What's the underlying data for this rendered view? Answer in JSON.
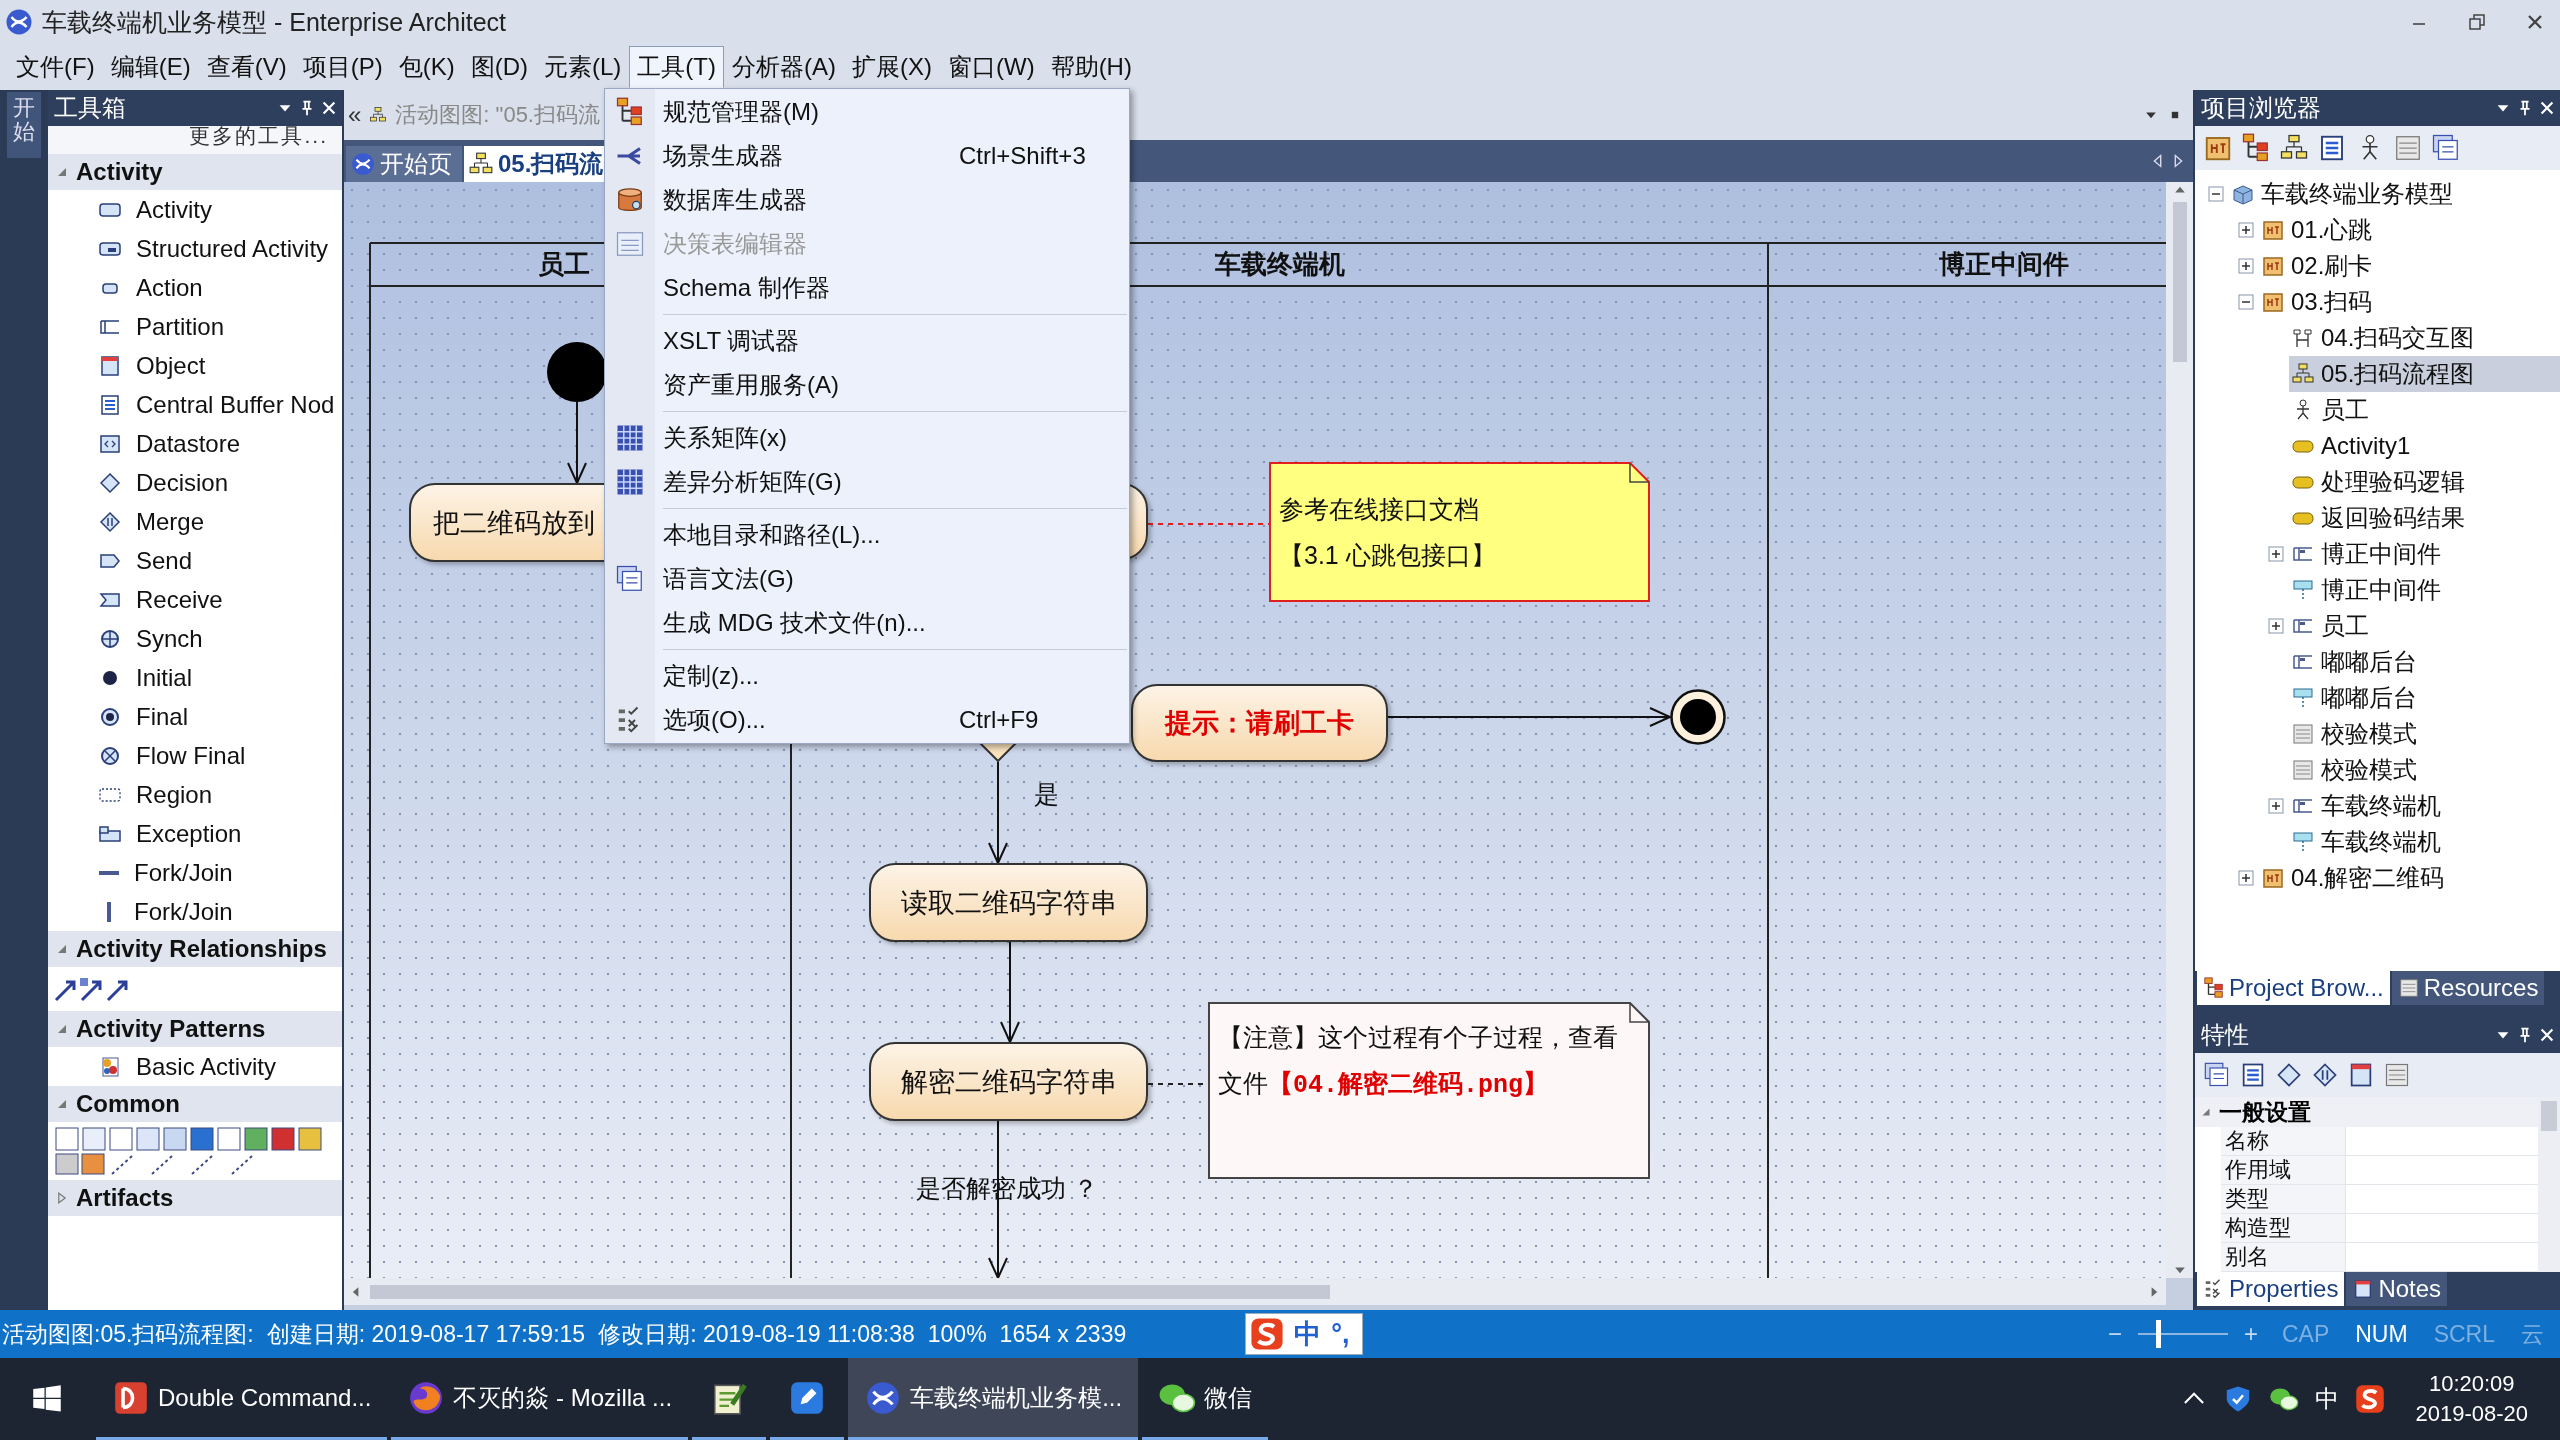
{
  "window": {
    "title": "车载终端机业务模型 - Enterprise Architect"
  },
  "menu_bar": [
    {
      "label": "文件(F)",
      "selected": false
    },
    {
      "label": "编辑(E)",
      "selected": false
    },
    {
      "label": "查看(V)",
      "selected": false
    },
    {
      "label": "项目(P)",
      "selected": false
    },
    {
      "label": "包(K)",
      "selected": false
    },
    {
      "label": "图(D)",
      "selected": false
    },
    {
      "label": "元素(L)",
      "selected": false
    },
    {
      "label": "工具(T)",
      "selected": true
    },
    {
      "label": "分析器(A)",
      "selected": false
    },
    {
      "label": "扩展(X)",
      "selected": false
    },
    {
      "label": "窗口(W)",
      "selected": false
    },
    {
      "label": "帮助(H)",
      "selected": false
    }
  ],
  "side_strip": {
    "tab": "开始"
  },
  "toolbox": {
    "title": "工具箱",
    "more": "更多的工具...",
    "sections": [
      {
        "title": "Activity",
        "expanded": true,
        "kind": "list",
        "items": [
          {
            "label": "Activity",
            "kind": "activity"
          },
          {
            "label": "Structured Activity",
            "kind": "structured"
          },
          {
            "label": "Action",
            "kind": "action"
          },
          {
            "label": "Partition",
            "kind": "partition"
          },
          {
            "label": "Object",
            "kind": "object"
          },
          {
            "label": "Central Buffer Nod",
            "kind": "buffer"
          },
          {
            "label": "Datastore",
            "kind": "datastore"
          },
          {
            "label": "Decision",
            "kind": "decision"
          },
          {
            "label": "Merge",
            "kind": "merge"
          },
          {
            "label": "Send",
            "kind": "send"
          },
          {
            "label": "Receive",
            "kind": "receive"
          },
          {
            "label": "Synch",
            "kind": "synch"
          },
          {
            "label": "Initial",
            "kind": "initial"
          },
          {
            "label": "Final",
            "kind": "final"
          },
          {
            "label": "Flow Final",
            "kind": "flowfinal"
          },
          {
            "label": "Region",
            "kind": "region"
          },
          {
            "label": "Exception",
            "kind": "exception"
          },
          {
            "label": "Fork/Join",
            "kind": "forkh"
          },
          {
            "label": "Fork/Join",
            "kind": "forkv"
          }
        ]
      },
      {
        "title": "Activity Relationships",
        "expanded": true,
        "kind": "arrows"
      },
      {
        "title": "Activity Patterns",
        "expanded": true,
        "kind": "list",
        "items": [
          {
            "label": "Basic Activity",
            "kind": "pattern"
          }
        ]
      },
      {
        "title": "Common",
        "expanded": true,
        "kind": "tools"
      },
      {
        "title": "Artifacts",
        "expanded": false
      }
    ]
  },
  "document": {
    "back": "«",
    "caption": "活动图图: \"05.扫码流",
    "tabs": [
      {
        "label": "开始页",
        "kind": "start",
        "selected": false
      },
      {
        "label": "05.扫码流",
        "kind": "flow",
        "selected": true
      }
    ]
  },
  "tools_menu": {
    "groups": [
      [
        {
          "label": "规范管理器(M)",
          "kind": "tree",
          "disabled": false
        },
        {
          "label": "场景生成器",
          "kind": "branch",
          "shortcut": "Ctrl+Shift+3",
          "disabled": false
        },
        {
          "label": "数据库生成器",
          "kind": "database",
          "disabled": false
        },
        {
          "label": "决策表编辑器",
          "kind": "table",
          "disabled": true
        },
        {
          "label": "Schema 制作器",
          "kind": "plain",
          "disabled": false
        }
      ],
      [
        {
          "label": "XSLT 调试器",
          "kind": "plain",
          "disabled": false
        },
        {
          "label": "资产重用服务(A)",
          "kind": "plain",
          "disabled": false
        }
      ],
      [
        {
          "label": "关系矩阵(x)",
          "kind": "matrix",
          "disabled": false
        },
        {
          "label": "差异分析矩阵(G)",
          "kind": "matrix",
          "disabled": false
        }
      ],
      [
        {
          "label": "本地目录和路径(L)...",
          "kind": "plain",
          "disabled": false
        },
        {
          "label": "语言文法(G)",
          "kind": "stack",
          "disabled": false
        },
        {
          "label": "生成 MDG 技术文件(n)...",
          "kind": "plain",
          "disabled": false
        }
      ],
      [
        {
          "label": "定制(z)...",
          "kind": "plain",
          "disabled": false
        },
        {
          "label": "选项(O)...",
          "kind": "checklist",
          "shortcut": "Ctrl+F9",
          "disabled": false
        }
      ]
    ]
  },
  "diagram": {
    "lanes": [
      {
        "title": "员工"
      },
      {
        "title": "车载终端机"
      },
      {
        "title": "博正中间件"
      }
    ],
    "nodes": [
      {
        "kind": "initial"
      },
      {
        "kind": "action",
        "text": "把二维码放到"
      },
      {
        "kind": "action"
      },
      {
        "kind": "note",
        "color": "#ffff80",
        "lines": [
          "参考在线接口文档",
          "【3.1 心跳包接口】"
        ]
      },
      {
        "kind": "decision"
      },
      {
        "kind": "message",
        "text": "提示：请刷工卡"
      },
      {
        "kind": "final"
      },
      {
        "kind": "label",
        "text": "是"
      },
      {
        "kind": "action",
        "text": "读取二维码字符串"
      },
      {
        "kind": "action",
        "text": "解密二维码字符串"
      },
      {
        "kind": "note",
        "color": "#fdf7f7",
        "lines": [
          "【注意】这个过程有个子过程，查看文件**【04.解密二维码.png】**"
        ]
      },
      {
        "kind": "label",
        "text": "是否解密成功 ？"
      }
    ]
  },
  "project_browser": {
    "title": "项目浏览器",
    "tree": [
      {
        "label": "车载终端业务模型",
        "kind": "model",
        "expanded": true,
        "selected": false,
        "children": [
          {
            "label": "01.心跳",
            "kind": "package",
            "expanded": false,
            "selected": false
          },
          {
            "label": "02.刷卡",
            "kind": "package",
            "expanded": false,
            "selected": false
          },
          {
            "label": "03.扫码",
            "kind": "package",
            "expanded": true,
            "selected": false,
            "children": [
              {
                "label": "04.扫码交互图",
                "kind": "seqdiagram",
                "selected": false
              },
              {
                "label": "05.扫码流程图",
                "kind": "flowdiagram",
                "selected": true
              },
              {
                "label": "员工",
                "kind": "actor",
                "selected": false
              },
              {
                "label": "Activity1",
                "kind": "activity",
                "selected": false
              },
              {
                "label": "处理验码逻辑",
                "kind": "activity",
                "selected": false
              },
              {
                "label": "返回验码结果",
                "kind": "activity",
                "selected": false
              },
              {
                "label": "博正中间件",
                "kind": "partition",
                "expanded": false,
                "selected": false
              },
              {
                "label": "博正中间件",
                "kind": "lifeline",
                "selected": false
              },
              {
                "label": "员工",
                "kind": "partition",
                "expanded": false,
                "selected": false
              },
              {
                "label": "嘟嘟后台",
                "kind": "partition",
                "selected": false
              },
              {
                "label": "嘟嘟后台",
                "kind": "lifeline",
                "selected": false
              },
              {
                "label": "校验模式",
                "kind": "pattern",
                "selected": false
              },
              {
                "label": "校验模式",
                "kind": "pattern",
                "selected": false
              },
              {
                "label": "车载终端机",
                "kind": "partition",
                "expanded": false,
                "selected": false
              },
              {
                "label": "车载终端机",
                "kind": "lifeline",
                "selected": false
              }
            ]
          },
          {
            "label": "04.解密二维码",
            "kind": "package",
            "expanded": false,
            "selected": false
          }
        ]
      }
    ],
    "tabs": [
      {
        "label": "Project Brow...",
        "selected": true
      },
      {
        "label": "Resources",
        "selected": false
      }
    ]
  },
  "properties": {
    "title": "特性",
    "group": {
      "title": "一般设置",
      "expanded": true,
      "fields": [
        "名称",
        "作用域",
        "类型",
        "构造型",
        "别名"
      ]
    },
    "tabs": [
      {
        "label": "Properties",
        "selected": true
      },
      {
        "label": "Notes",
        "selected": false
      }
    ]
  },
  "status_bar": {
    "diagram": "活动图图:05.扫码流程图:",
    "created": "创建日期: 2019-08-17 17:59:15",
    "modified": "修改日期: 2019-08-19 11:08:38",
    "zoom": "100%",
    "size": "1654 x 2339",
    "ime": [
      "中",
      "°,"
    ],
    "zoom_out": "−",
    "zoom_in": "+",
    "zoom_slider": {
      "level": 0.2
    },
    "indicators": [
      {
        "label": "CAP",
        "on": false
      },
      {
        "label": "NUM",
        "on": true
      },
      {
        "label": "SCRL",
        "on": false
      },
      {
        "label": "云",
        "on": false
      }
    ]
  },
  "taskbar": {
    "apps": [
      {
        "label": "Double Command...",
        "kind": "dc",
        "selected": false
      },
      {
        "label": "不灭的焱 - Mozilla ...",
        "kind": "browser",
        "selected": false
      },
      {
        "kind": "notepad",
        "selected": false
      },
      {
        "kind": "pen",
        "selected": false
      },
      {
        "label": "车载终端机业务模...",
        "kind": "ea",
        "selected": true
      },
      {
        "label": "微信",
        "kind": "chat",
        "selected": false
      }
    ],
    "tray_ime": "中",
    "time": "10:20:09",
    "date": "2019-08-20"
  }
}
